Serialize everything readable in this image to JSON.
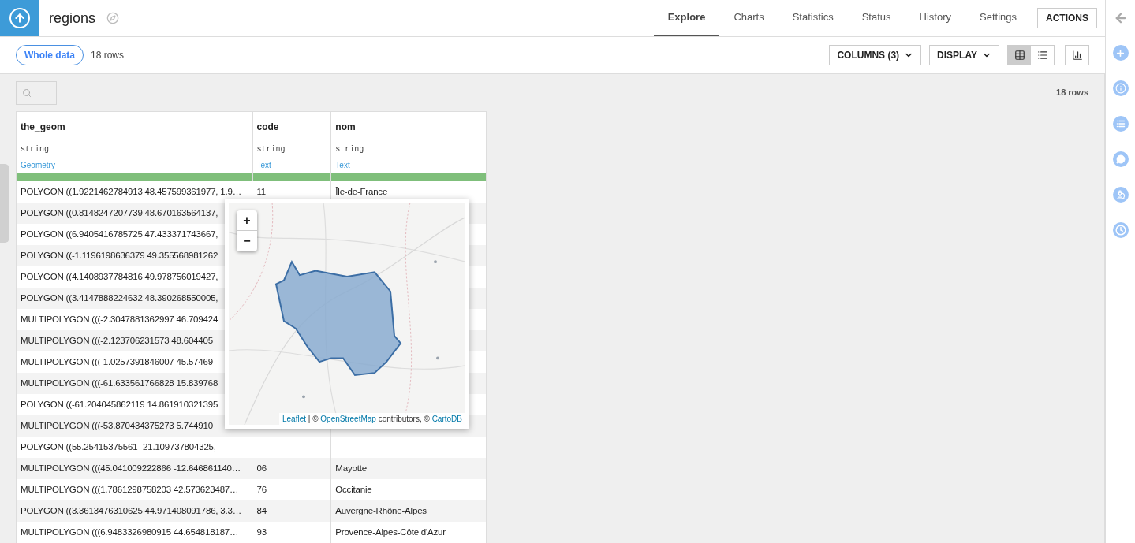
{
  "header": {
    "title": "regions",
    "tabs": [
      {
        "label": "Explore",
        "selected": true
      },
      {
        "label": "Charts",
        "selected": false
      },
      {
        "label": "Statistics",
        "selected": false
      },
      {
        "label": "Status",
        "selected": false
      },
      {
        "label": "History",
        "selected": false
      },
      {
        "label": "Settings",
        "selected": false
      }
    ],
    "actions": "ACTIONS"
  },
  "toolbar": {
    "sample": "Whole data",
    "row_count": "18 rows",
    "columns_button": "COLUMNS (3)",
    "display_button": "DISPLAY",
    "view_buttons": [
      {
        "kind": "table",
        "selected": true
      },
      {
        "kind": "list",
        "selected": false
      }
    ]
  },
  "table_bar": {
    "row_count": "18 rows"
  },
  "table": {
    "columns": [
      {
        "name": "the_geom",
        "type": "string",
        "meaning": "Geometry",
        "level": 1
      },
      {
        "name": "code",
        "type": "string",
        "meaning": "Text",
        "level": 1
      },
      {
        "name": "nom",
        "type": "string",
        "meaning": "Text",
        "level": 1
      }
    ],
    "rows": [
      {
        "the_geom": "POLYGON ((1.9221462784913 48.457599361977, 1.9…",
        "code": "11",
        "nom": "Île-de-France"
      },
      {
        "the_geom": "POLYGON ((0.8148247207739 48.670163564137,"
      },
      {
        "the_geom": "POLYGON ((6.9405416785725 47.433371743667,"
      },
      {
        "the_geom": "POLYGON ((-1.1196198636379 49.355568981262"
      },
      {
        "the_geom": "POLYGON ((4.1408937784816 49.978756019427,"
      },
      {
        "the_geom": "POLYGON ((3.4147888224632 48.390268550005,"
      },
      {
        "the_geom": "MULTIPOLYGON (((-2.3047881362997 46.709424"
      },
      {
        "the_geom": "MULTIPOLYGON (((-2.123706231573 48.604405"
      },
      {
        "the_geom": "MULTIPOLYGON (((-1.0257391846007 45.57469"
      },
      {
        "the_geom": "MULTIPOLYGON (((-61.633561766828 15.839768"
      },
      {
        "the_geom": "POLYGON ((-61.204045862119 14.861910321395"
      },
      {
        "the_geom": "MULTIPOLYGON (((-53.870434375273 5.744910"
      },
      {
        "the_geom": "POLYGON ((55.25415375561 -21.109737804325,"
      },
      {
        "the_geom": "MULTIPOLYGON (((45.041009222866 -12.646861140…",
        "code": "06",
        "nom": "Mayotte"
      },
      {
        "the_geom": "MULTIPOLYGON (((1.7861298758203 42.573623487…",
        "code": "76",
        "nom": "Occitanie"
      },
      {
        "the_geom": "POLYGON ((3.3613476310625 44.971408091786, 3.3…",
        "code": "84",
        "nom": "Auvergne-Rhône-Alpes"
      },
      {
        "the_geom": "MULTIPOLYGON (((6.9483326980915 44.654818187…",
        "code": "93",
        "nom": "Provence-Alpes-Côte d'Azur"
      }
    ]
  },
  "map_popup": {
    "zoom_in": "+",
    "zoom_out": "−",
    "attribution": [
      {
        "kind": "link",
        "text": "Leaflet"
      },
      {
        "kind": "text",
        "text": " | © "
      },
      {
        "kind": "link",
        "text": "OpenStreetMap"
      },
      {
        "kind": "text",
        "text": " contributors, © "
      },
      {
        "kind": "link",
        "text": "CartoDB"
      }
    ]
  },
  "right_rail": [
    {
      "kind": "back"
    },
    {
      "kind": "add"
    },
    {
      "kind": "info"
    },
    {
      "kind": "list"
    },
    {
      "kind": "chat"
    },
    {
      "kind": "lab"
    },
    {
      "kind": "clock"
    }
  ]
}
